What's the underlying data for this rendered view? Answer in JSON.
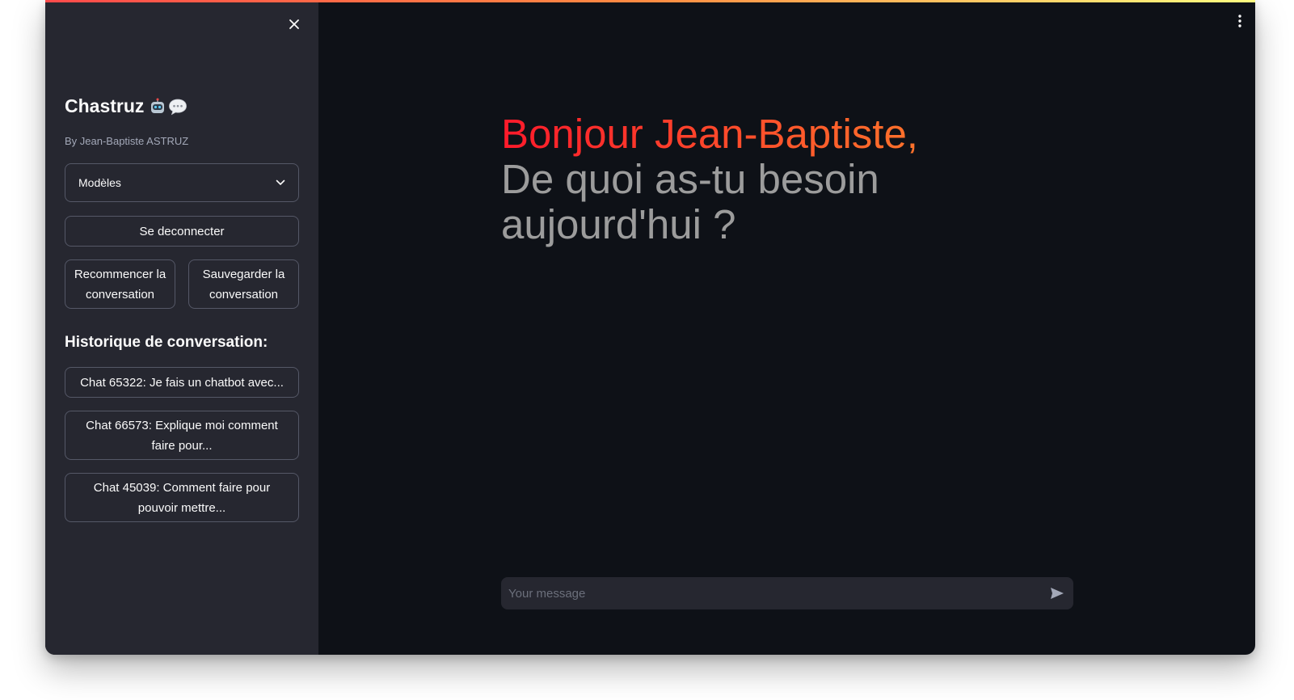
{
  "colors": {
    "background": "#0e1117",
    "sidebar": "#262730",
    "greeting_gradient_start": "#ff1a2b",
    "greeting_gradient_end": "#ff7a2b",
    "greeting_secondary": "#9c9c9c",
    "top_bar_gradient": [
      "#ff4b4b",
      "#fffd80"
    ]
  },
  "sidebar": {
    "close_icon": "close-icon",
    "title": "Chastruz",
    "title_icons": [
      "robot-emoji-icon",
      "speech-bubble-emoji-icon"
    ],
    "author": "By Jean-Baptiste ASTRUZ",
    "model_select": {
      "label": "Modèles",
      "icon": "chevron-down-icon"
    },
    "logout_label": "Se deconnecter",
    "restart_label": "Recommencer la conversation",
    "save_label": "Sauvegarder la conversation",
    "history_heading": "Historique de conversation:",
    "history_items": [
      {
        "label": "Chat 65322: Je fais un chatbot avec..."
      },
      {
        "label": "Chat 66573: Explique moi comment faire pour..."
      },
      {
        "label": "Chat 45039: Comment faire pour pouvoir mettre..."
      }
    ]
  },
  "main": {
    "menu_icon": "more-vertical-icon",
    "greeting_line1": "Bonjour Jean-Baptiste,",
    "greeting_line2": "De quoi as-tu besoin aujourd'hui ?",
    "input": {
      "placeholder": "Your message",
      "value": "",
      "send_icon": "send-icon"
    }
  }
}
